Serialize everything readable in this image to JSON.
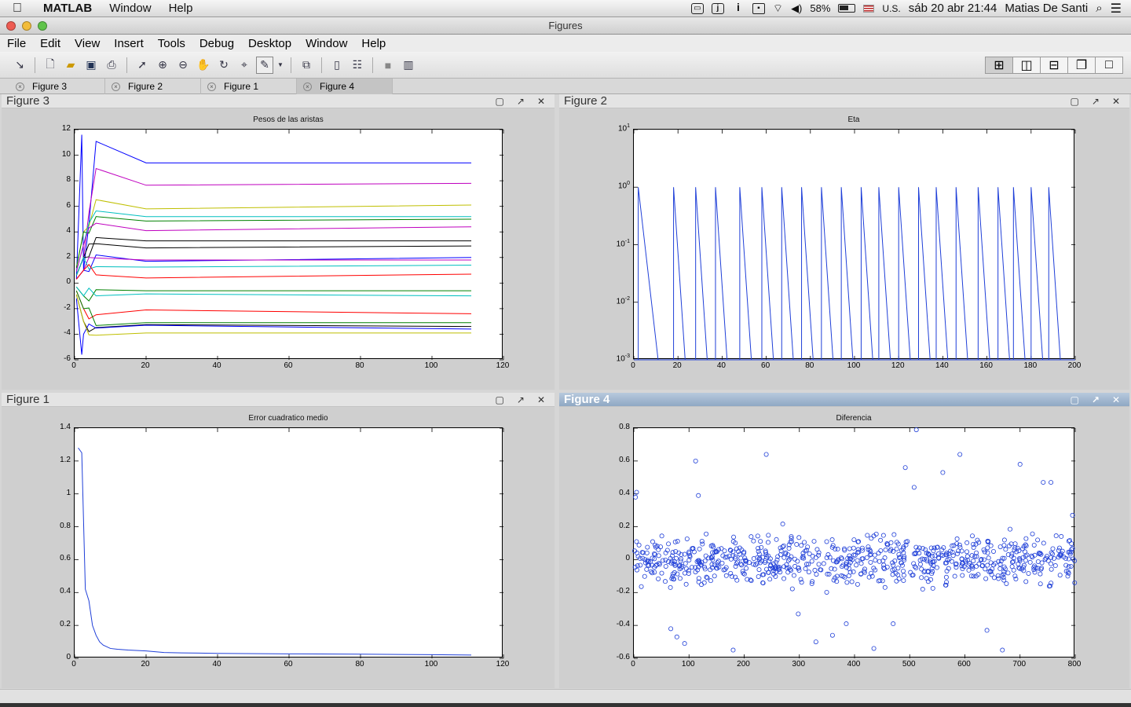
{
  "menubar": {
    "app": "MATLAB",
    "items": [
      "Window",
      "Help"
    ],
    "battery": "58%",
    "input": "U.S.",
    "datetime": "sáb 20 abr  21:44",
    "user": "Matias De Santi"
  },
  "window": {
    "title": "Figures"
  },
  "appmenu": [
    "File",
    "Edit",
    "View",
    "Insert",
    "Tools",
    "Debug",
    "Desktop",
    "Window",
    "Help"
  ],
  "tabs": [
    "Figure 3",
    "Figure 2",
    "Figure 1",
    "Figure 4"
  ],
  "active_tab": "Figure 4",
  "colors": {
    "blue": "#1f3fd8",
    "accent": "#8fa8c4"
  },
  "panels": {
    "p3": {
      "label": "Figure 3"
    },
    "p2": {
      "label": "Figure 2"
    },
    "p1": {
      "label": "Figure 1"
    },
    "p4": {
      "label": "Figure 4"
    }
  },
  "chart_data": [
    {
      "type": "line",
      "title": "Pesos de las aristas",
      "xlim": [
        0,
        120
      ],
      "ylim": [
        -6,
        12
      ],
      "xticks": [
        0,
        20,
        40,
        60,
        80,
        100,
        120
      ],
      "yticks": [
        -6,
        -4,
        -2,
        0,
        2,
        4,
        6,
        8,
        10,
        12
      ],
      "series": [
        {
          "color": "#0000ff",
          "start": 1,
          "end": 9.4,
          "spike": 11.6
        },
        {
          "color": "#bf00bf",
          "start": 2,
          "end": 7.8
        },
        {
          "color": "#bfbf00",
          "start": 4,
          "end": 6.1
        },
        {
          "color": "#00bfbf",
          "start": 3,
          "end": 5.2
        },
        {
          "color": "#008000",
          "start": 4,
          "end": 5.0
        },
        {
          "color": "#bf00bf",
          "start": 3,
          "end": 4.4
        },
        {
          "color": "#000000",
          "start": 2,
          "end": 3.3
        },
        {
          "color": "#000000",
          "start": 2,
          "end": 2.9
        },
        {
          "color": "#0000ff",
          "start": 1,
          "end": 2.0
        },
        {
          "color": "#bf00bf",
          "start": 1,
          "end": 1.8
        },
        {
          "color": "#00bfbf",
          "start": 2,
          "end": 1.4
        },
        {
          "color": "#ff0000",
          "start": 1,
          "end": 0.7
        },
        {
          "color": "#008000",
          "start": -1,
          "end": -0.6
        },
        {
          "color": "#00bfbf",
          "start": -1,
          "end": -1.0
        },
        {
          "color": "#ff0000",
          "start": -2,
          "end": -2.4
        },
        {
          "color": "#008000",
          "start": -2,
          "end": -3.1
        },
        {
          "color": "#000000",
          "start": -3,
          "end": -3.4
        },
        {
          "color": "#0000ff",
          "start": -4,
          "end": -3.6,
          "spike": -5.6
        },
        {
          "color": "#bfbf00",
          "start": -3,
          "end": -3.9
        }
      ]
    },
    {
      "type": "line",
      "title": "Eta",
      "yscale": "log",
      "xlim": [
        0,
        200
      ],
      "ylim": [
        0.001,
        10
      ],
      "xticks": [
        0,
        20,
        40,
        60,
        80,
        100,
        120,
        140,
        160,
        180,
        200
      ],
      "yticks_exp": [
        1,
        0,
        -1,
        -2,
        -3
      ],
      "peaks_x": [
        2,
        18,
        28,
        37,
        48,
        58,
        67,
        76,
        85,
        94,
        103,
        111,
        120,
        129,
        137,
        146,
        156,
        165,
        172,
        180,
        188
      ],
      "peak_value": 1
    },
    {
      "type": "line",
      "title": "Error cuadratico medio",
      "xlim": [
        0,
        120
      ],
      "ylim": [
        0,
        1.4
      ],
      "xticks": [
        0,
        20,
        40,
        60,
        80,
        100,
        120
      ],
      "yticks": [
        0,
        0.2,
        0.4,
        0.6,
        0.8,
        1,
        1.2,
        1.4
      ],
      "x": [
        1,
        2,
        3,
        4,
        5,
        6,
        7,
        8,
        10,
        12,
        15,
        20,
        25,
        30,
        40,
        60,
        80,
        100,
        111
      ],
      "y": [
        1.28,
        1.25,
        0.42,
        0.35,
        0.2,
        0.14,
        0.1,
        0.08,
        0.06,
        0.055,
        0.05,
        0.045,
        0.035,
        0.033,
        0.03,
        0.027,
        0.025,
        0.022,
        0.02
      ]
    },
    {
      "type": "scatter",
      "title": "Diferencia",
      "xlim": [
        0,
        800
      ],
      "ylim": [
        -0.6,
        0.8
      ],
      "xticks": [
        0,
        100,
        200,
        300,
        400,
        500,
        600,
        700,
        800
      ],
      "yticks": [
        -0.6,
        -0.4,
        -0.2,
        0,
        0.2,
        0.4,
        0.6,
        0.8
      ],
      "n_points": 800,
      "marker": "circle",
      "points": [
        [
          3,
          0.38
        ],
        [
          5,
          0.41
        ],
        [
          67,
          -0.42
        ],
        [
          78,
          -0.47
        ],
        [
          92,
          -0.51
        ],
        [
          112,
          0.6
        ],
        [
          117,
          0.39
        ],
        [
          180,
          -0.55
        ],
        [
          240,
          0.64
        ],
        [
          298,
          -0.33
        ],
        [
          330,
          -0.5
        ],
        [
          360,
          -0.46
        ],
        [
          385,
          -0.39
        ],
        [
          435,
          -0.54
        ],
        [
          470,
          -0.39
        ],
        [
          492,
          0.56
        ],
        [
          512,
          0.79
        ],
        [
          508,
          0.44
        ],
        [
          560,
          0.53
        ],
        [
          591,
          0.64
        ],
        [
          640,
          -0.43
        ],
        [
          668,
          -0.55
        ],
        [
          700,
          0.58
        ],
        [
          742,
          0.47
        ],
        [
          756,
          0.47
        ],
        [
          795,
          0.27
        ]
      ]
    }
  ]
}
